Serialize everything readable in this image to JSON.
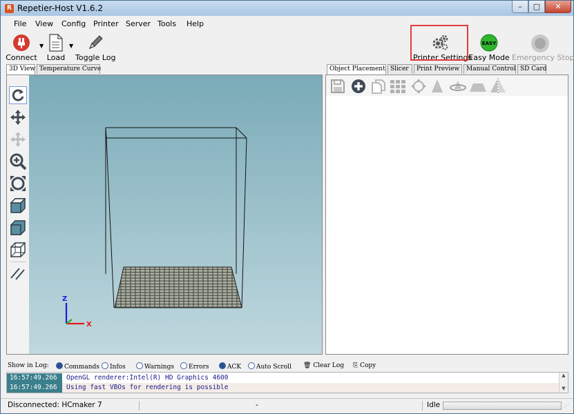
{
  "window": {
    "title": "Repetier-Host V1.6.2",
    "app_icon_letter": "R",
    "min": "–",
    "max": "□",
    "close": "✕"
  },
  "menu": [
    "File",
    "View",
    "Config",
    "Printer",
    "Server",
    "Tools",
    "Help"
  ],
  "toolbar": {
    "connect": "Connect",
    "load": "Load",
    "toggle_log": "Toggle Log",
    "printer_settings": "Printer Settings",
    "easy_mode": "Easy Mode",
    "easy_badge": "EASY",
    "emergency_stop": "Emergency Stop"
  },
  "left_tabs": [
    "3D View",
    "Temperature Curve"
  ],
  "right_tabs": [
    "Object Placement",
    "Slicer",
    "Print Preview",
    "Manual Control",
    "SD Card"
  ],
  "axes": {
    "z": "Z",
    "x": "X"
  },
  "log_bar": {
    "show_in_log": "Show in Log:",
    "options": [
      "Commands",
      "Infos",
      "Warnings",
      "Errors",
      "ACK",
      "Auto Scroll"
    ],
    "clear_log": "Clear Log",
    "copy": "Copy"
  },
  "log": [
    {
      "time": "16:57:49.266",
      "msg": "OpenGL renderer:Intel(R) HD Graphics 4600"
    },
    {
      "time": "16:57:49.266",
      "msg": "Using fast VBOs for rendering is possible"
    }
  ],
  "status": {
    "connection": "Disconnected: HCmaker 7",
    "middle": "-",
    "state": "Idle"
  },
  "colors": {
    "highlight": "#e23b3b",
    "easy_green": "#2fb52f",
    "log_time_bg": "#3c7f8c"
  }
}
